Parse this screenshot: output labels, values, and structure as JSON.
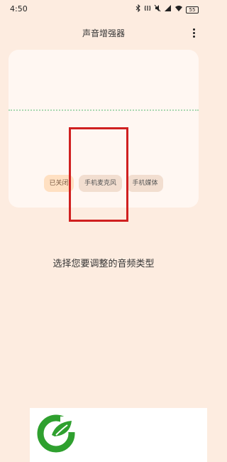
{
  "status_bar": {
    "time": "4:50",
    "icons": [
      "bluetooth-icon",
      "nfc-icon",
      "mute-icon",
      "signal-icon",
      "wifi-icon"
    ],
    "battery": "55"
  },
  "app_bar": {
    "title": "声音增强器",
    "menu_icon": "more-vert-icon"
  },
  "audio_sources": {
    "chips": [
      {
        "label": "已关闭",
        "state": "selected"
      },
      {
        "label": "手机麦克风",
        "state": "default"
      },
      {
        "label": "手机媒体",
        "state": "default"
      }
    ]
  },
  "prompt": "选择您要调整的音频类型",
  "colors": {
    "background": "#fdece0",
    "card": "#fff7f2",
    "chip_selected": "#ffe0c2",
    "chip_default": "#f2ded0",
    "dotted_line": "#a9d8b1",
    "highlight": "#d02020",
    "logo_green": "#2fa02f"
  }
}
